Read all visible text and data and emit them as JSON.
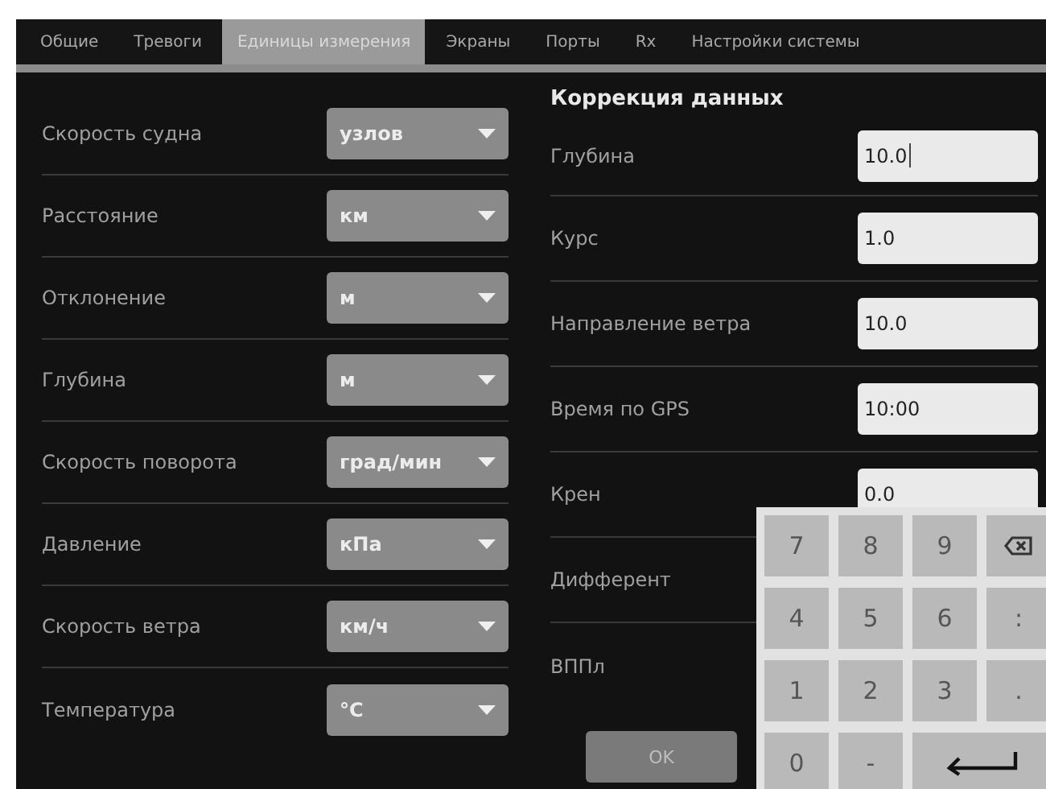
{
  "tabs": [
    {
      "label": "Общие",
      "selected": false
    },
    {
      "label": "Тревоги",
      "selected": false
    },
    {
      "label": "Единицы измерения",
      "selected": true
    },
    {
      "label": "Экраны",
      "selected": false
    },
    {
      "label": "Порты",
      "selected": false
    },
    {
      "label": "Rx",
      "selected": false
    },
    {
      "label": "Настройки системы",
      "selected": false
    }
  ],
  "units": [
    {
      "label": "Скорость судна",
      "value": "узлов"
    },
    {
      "label": "Расстояние",
      "value": "км"
    },
    {
      "label": "Отклонение",
      "value": "м"
    },
    {
      "label": "Глубина",
      "value": "м"
    },
    {
      "label": "Скорость поворота",
      "value": "град/мин"
    },
    {
      "label": "Давление",
      "value": "кПа"
    },
    {
      "label": "Скорость ветра",
      "value": "км/ч"
    },
    {
      "label": "Температура",
      "value": "°C"
    }
  ],
  "correction": {
    "title": "Коррекция данных",
    "rows": [
      {
        "label": "Глубина",
        "value": "10.0",
        "focused": true
      },
      {
        "label": "Курс",
        "value": "1.0"
      },
      {
        "label": "Направление ветра",
        "value": "10.0"
      },
      {
        "label": "Время по GPS",
        "value": "10:00"
      },
      {
        "label": "Крен",
        "value": "0.0"
      },
      {
        "label": "Дифферент"
      },
      {
        "label": "ВППл"
      }
    ],
    "ok_button": "OK"
  },
  "keypad": [
    {
      "kind": "char",
      "label": "7"
    },
    {
      "kind": "char",
      "label": "8"
    },
    {
      "kind": "char",
      "label": "9"
    },
    {
      "kind": "backspace"
    },
    {
      "kind": "char",
      "label": "4"
    },
    {
      "kind": "char",
      "label": "5"
    },
    {
      "kind": "char",
      "label": "6"
    },
    {
      "kind": "char",
      "label": ":"
    },
    {
      "kind": "char",
      "label": "1"
    },
    {
      "kind": "char",
      "label": "2"
    },
    {
      "kind": "char",
      "label": "3"
    },
    {
      "kind": "char",
      "label": "."
    },
    {
      "kind": "char",
      "label": "0"
    },
    {
      "kind": "char",
      "label": "-"
    },
    {
      "kind": "enter"
    }
  ]
}
